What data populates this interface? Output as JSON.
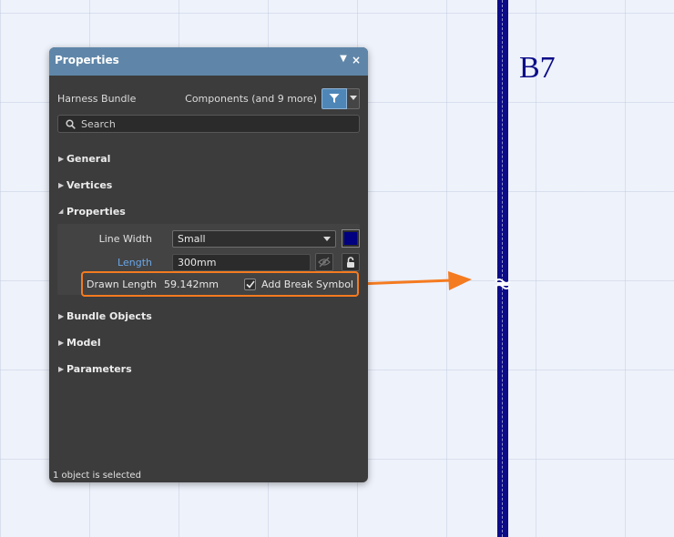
{
  "canvas": {
    "sheet_label": "B7",
    "wire_color": "#0c0c88",
    "highlight_color": "#f47b20"
  },
  "panel": {
    "title": "Properties",
    "menu_icon": "dropdown-arrow-icon",
    "close_icon": "close-icon",
    "object_type": "Harness Bundle",
    "filter_text": "Components (and 9 more)",
    "filter_icon": "filter-icon",
    "search_placeholder": "Search",
    "sections": {
      "general": "General",
      "vertices": "Vertices",
      "properties": "Properties",
      "bundle_objects": "Bundle Objects",
      "model": "Model",
      "parameters": "Parameters"
    },
    "properties": {
      "line_width_label": "Line Width",
      "line_width_value": "Small",
      "color_value": "#000080",
      "length_label": "Length",
      "length_value": "300mm",
      "drawn_length_label": "Drawn Length",
      "drawn_length_value": "59.142mm",
      "add_break_symbol_label": "Add Break Symbol",
      "add_break_symbol_checked": true
    },
    "status": "1 object is selected"
  }
}
